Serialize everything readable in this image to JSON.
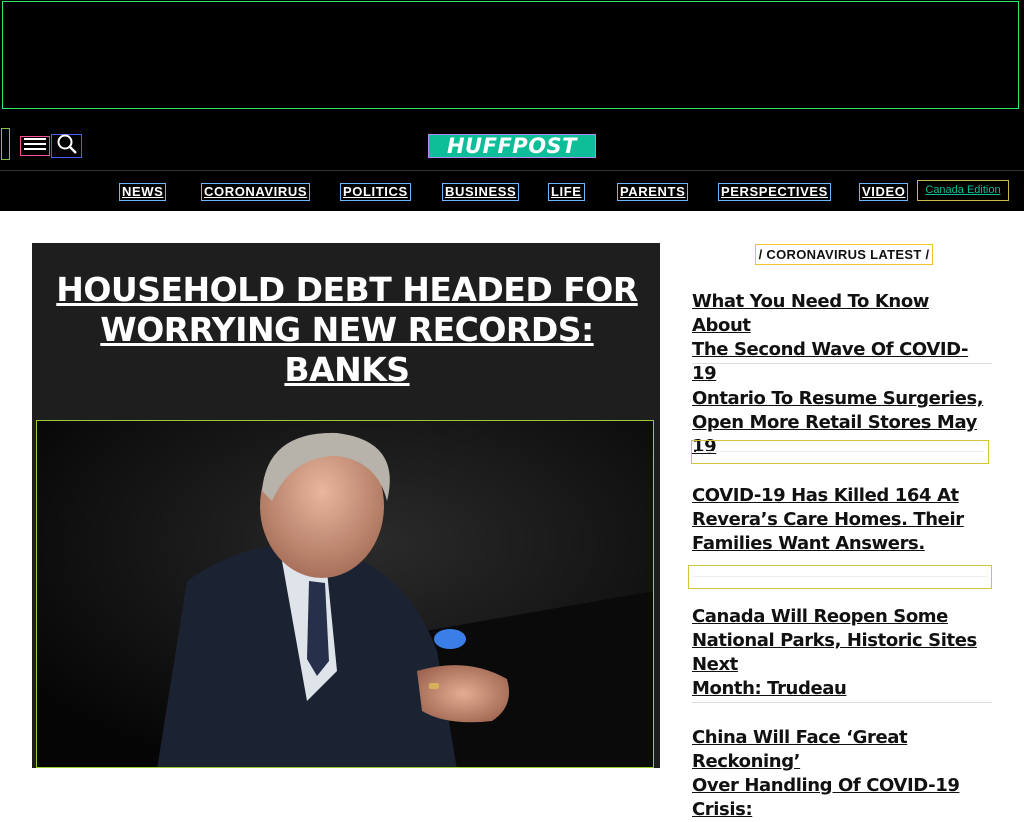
{
  "brand": {
    "logo_text": "HUFFPOST",
    "accent": "#0dbe98"
  },
  "header": {
    "menu_icon": "menu-icon",
    "search_icon": "search-icon"
  },
  "nav": {
    "items": [
      {
        "label": "NEWS"
      },
      {
        "label": "CORONAVIRUS"
      },
      {
        "label": "POLITICS"
      },
      {
        "label": "BUSINESS"
      },
      {
        "label": "LIFE"
      },
      {
        "label": "PARENTS"
      },
      {
        "label": "PERSPECTIVES"
      },
      {
        "label": "VIDEO"
      }
    ],
    "edition_label": "Canada Edition"
  },
  "hero": {
    "title_lines": [
      "HOUSEHOLD DEBT HEADED FOR",
      "WORRYING NEW RECORDS:",
      "BANKS"
    ]
  },
  "sidebar": {
    "section_label": "/  CORONAVIRUS LATEST  /",
    "stories": [
      {
        "lines": [
          "What You Need To Know About",
          "The Second Wave Of COVID-19"
        ]
      },
      {
        "lines": [
          "Ontario To Resume Surgeries,",
          "Open More Retail Stores May 19"
        ]
      },
      {
        "lines": [
          "COVID-19 Has Killed 164 At",
          "Revera’s Care Homes. Their",
          "Families Want Answers."
        ]
      },
      {
        "lines": [
          "Canada Will Reopen Some",
          "National Parks, Historic Sites Next",
          "Month: Trudeau"
        ]
      },
      {
        "lines": [
          "China Will Face ‘Great Reckoning’",
          "Over Handling Of COVID-19 Crisis:"
        ]
      }
    ]
  }
}
